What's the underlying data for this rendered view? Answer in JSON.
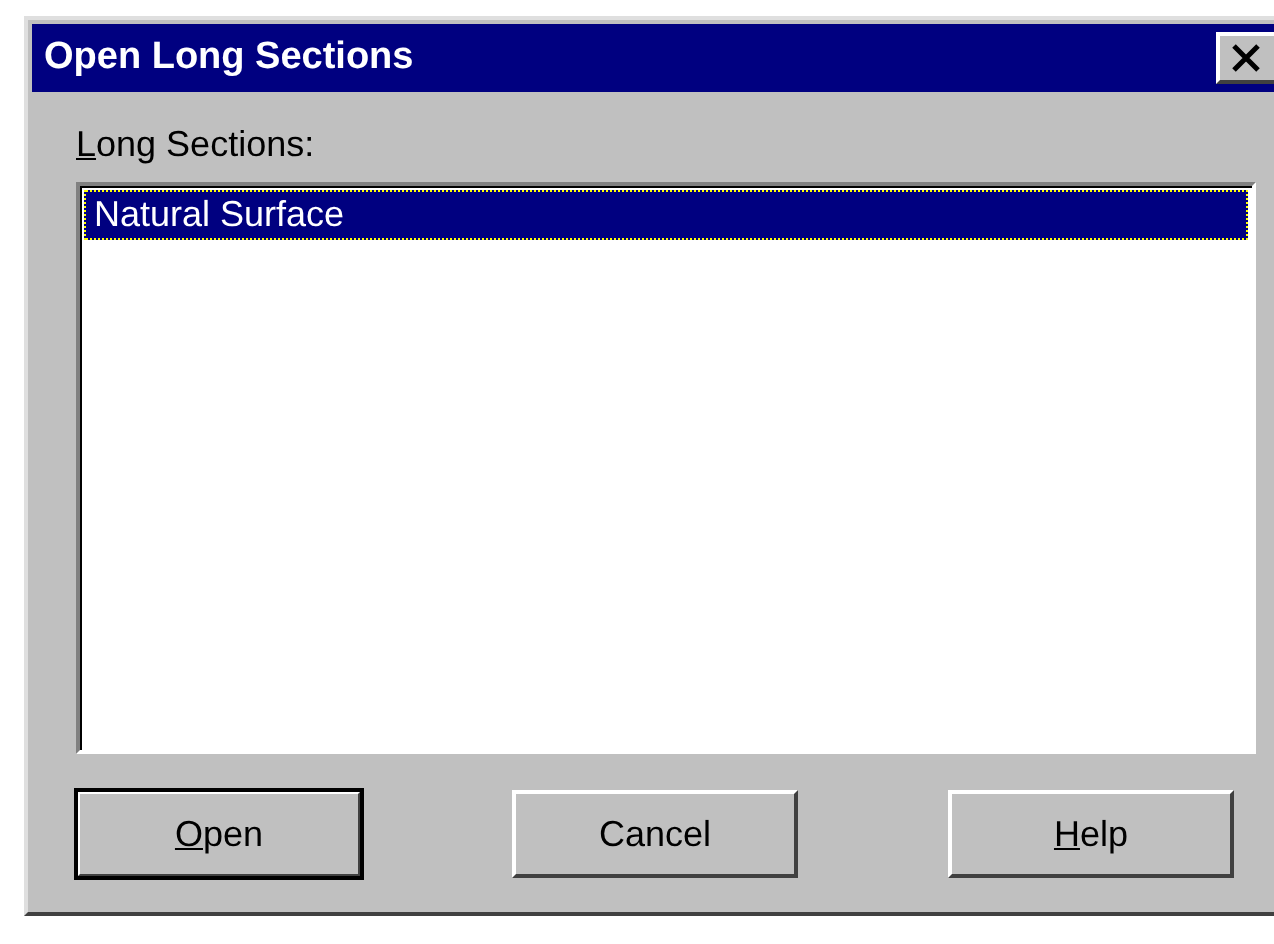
{
  "window": {
    "title": "Open Long Sections"
  },
  "list": {
    "label": "Long Sections:",
    "label_underline_first": true,
    "items": [
      {
        "text": "Natural Surface",
        "selected": true
      }
    ]
  },
  "buttons": [
    {
      "label": "Open",
      "default": true,
      "underline_first": true
    },
    {
      "label": "Cancel",
      "default": false,
      "underline_first": false
    },
    {
      "label": "Help",
      "default": false,
      "underline_first": true
    }
  ]
}
